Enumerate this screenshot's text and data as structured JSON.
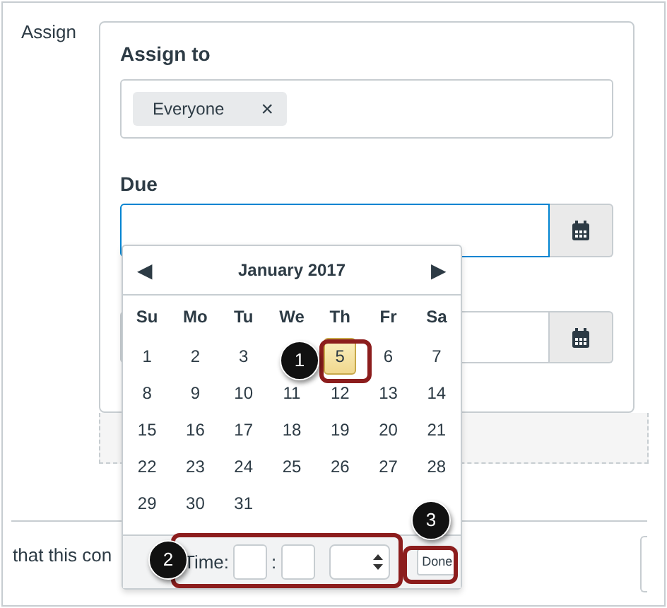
{
  "section_label": "Assign",
  "assign_to": {
    "label": "Assign to",
    "tokens": [
      {
        "text": "Everyone",
        "remove": "×"
      }
    ]
  },
  "due": {
    "label": "Due",
    "focused": true
  },
  "calendar": {
    "prev": "◀",
    "month": "January 2017",
    "next": "▶",
    "weekdays": [
      "Su",
      "Mo",
      "Tu",
      "We",
      "Th",
      "Fr",
      "Sa"
    ],
    "days": [
      {
        "kind": "day",
        "text": "1",
        "selected": false
      },
      {
        "kind": "day",
        "text": "2",
        "selected": false
      },
      {
        "kind": "day",
        "text": "3",
        "selected": false
      },
      {
        "kind": "covered"
      },
      {
        "kind": "day",
        "text": "5",
        "selected": true
      },
      {
        "kind": "day",
        "text": "6",
        "selected": false
      },
      {
        "kind": "day",
        "text": "7",
        "selected": false
      },
      {
        "kind": "day",
        "text": "8",
        "selected": false
      },
      {
        "kind": "day",
        "text": "9",
        "selected": false
      },
      {
        "kind": "day",
        "text": "10",
        "selected": false
      },
      {
        "kind": "day",
        "text": "11",
        "selected": false
      },
      {
        "kind": "day",
        "text": "12",
        "selected": false
      },
      {
        "kind": "day",
        "text": "13",
        "selected": false
      },
      {
        "kind": "day",
        "text": "14",
        "selected": false
      },
      {
        "kind": "day",
        "text": "15",
        "selected": false
      },
      {
        "kind": "day",
        "text": "16",
        "selected": false
      },
      {
        "kind": "day",
        "text": "17",
        "selected": false
      },
      {
        "kind": "day",
        "text": "18",
        "selected": false
      },
      {
        "kind": "day",
        "text": "19",
        "selected": false
      },
      {
        "kind": "day",
        "text": "20",
        "selected": false
      },
      {
        "kind": "day",
        "text": "21",
        "selected": false
      },
      {
        "kind": "day",
        "text": "22",
        "selected": false
      },
      {
        "kind": "day",
        "text": "23",
        "selected": false
      },
      {
        "kind": "day",
        "text": "24",
        "selected": false
      },
      {
        "kind": "day",
        "text": "25",
        "selected": false
      },
      {
        "kind": "day",
        "text": "26",
        "selected": false
      },
      {
        "kind": "day",
        "text": "27",
        "selected": false
      },
      {
        "kind": "day",
        "text": "28",
        "selected": false
      },
      {
        "kind": "day",
        "text": "29",
        "selected": false
      },
      {
        "kind": "day",
        "text": "30",
        "selected": false
      },
      {
        "kind": "day",
        "text": "31",
        "selected": false
      }
    ],
    "time_label": "Time:",
    "time_separator": ":",
    "done": "Done"
  },
  "callouts": [
    {
      "number": "1"
    },
    {
      "number": "2"
    },
    {
      "number": "3"
    }
  ],
  "footer_text": "that this con"
}
